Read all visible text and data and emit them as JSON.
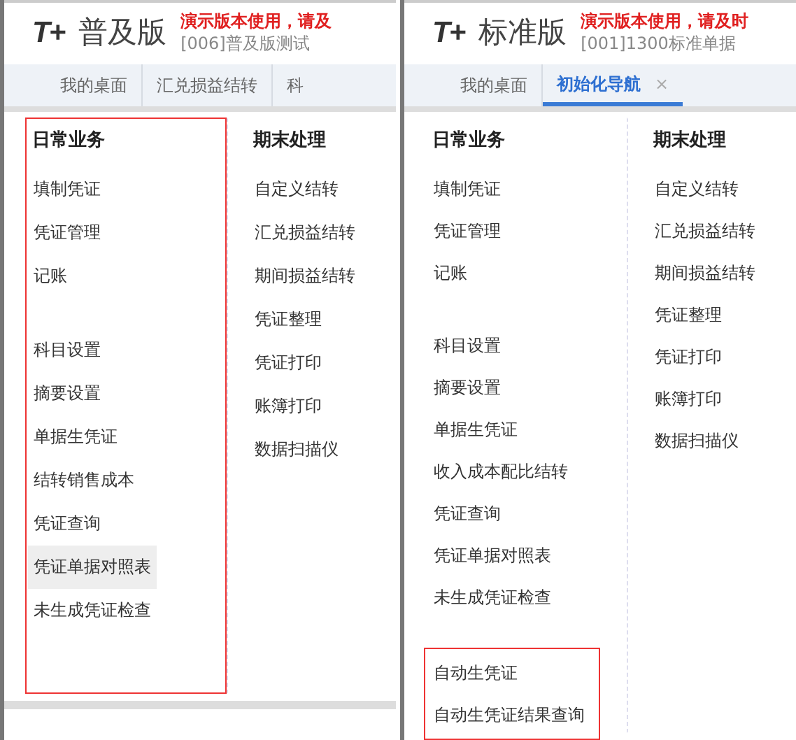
{
  "panels": [
    {
      "logo": {
        "mark": "T+",
        "edition": "普及版"
      },
      "notice": "演示版本使用，请及",
      "account": "[006]普及版测试",
      "tabs": [
        {
          "label": "我的桌面",
          "selected": false
        },
        {
          "label": "汇兑损益结转",
          "selected": false
        },
        {
          "label": "科",
          "selected": false
        }
      ],
      "columns": [
        {
          "title": "日常业务",
          "boxed": true,
          "groups": [
            {
              "items": [
                {
                  "label": "填制凭证",
                  "highlighted": false
                },
                {
                  "label": "凭证管理",
                  "highlighted": false
                },
                {
                  "label": "记账",
                  "highlighted": false
                }
              ]
            },
            {
              "items": [
                {
                  "label": "科目设置",
                  "highlighted": false
                },
                {
                  "label": "摘要设置",
                  "highlighted": false
                },
                {
                  "label": "单据生凭证",
                  "highlighted": false
                },
                {
                  "label": "结转销售成本",
                  "highlighted": false
                },
                {
                  "label": "凭证查询",
                  "highlighted": false
                },
                {
                  "label": "凭证单据对照表",
                  "highlighted": true
                },
                {
                  "label": "未生成凭证检查",
                  "highlighted": false
                }
              ]
            }
          ]
        },
        {
          "title": "期末处理",
          "groups": [
            {
              "items": [
                {
                  "label": "自定义结转",
                  "highlighted": false
                },
                {
                  "label": "汇兑损益结转",
                  "highlighted": false
                },
                {
                  "label": "期间损益结转",
                  "highlighted": false
                },
                {
                  "label": "凭证整理",
                  "highlighted": false
                },
                {
                  "label": "凭证打印",
                  "highlighted": false
                },
                {
                  "label": "账簿打印",
                  "highlighted": false
                },
                {
                  "label": "数据扫描仪",
                  "highlighted": false
                }
              ]
            }
          ]
        }
      ]
    },
    {
      "logo": {
        "mark": "T+",
        "edition": "标准版"
      },
      "notice": "演示版本使用，请及时",
      "account": "[001]1300标准单据",
      "tabs": [
        {
          "label": "我的桌面",
          "selected": false
        },
        {
          "label": "初始化导航",
          "selected": true,
          "close": "×"
        }
      ],
      "columns": [
        {
          "title": "日常业务",
          "groups": [
            {
              "items": [
                {
                  "label": "填制凭证",
                  "highlighted": false
                },
                {
                  "label": "凭证管理",
                  "highlighted": false
                },
                {
                  "label": "记账",
                  "highlighted": false
                }
              ]
            },
            {
              "items": [
                {
                  "label": "科目设置",
                  "highlighted": false
                },
                {
                  "label": "摘要设置",
                  "highlighted": false
                },
                {
                  "label": "单据生凭证",
                  "highlighted": false
                },
                {
                  "label": "收入成本配比结转",
                  "highlighted": false
                },
                {
                  "label": "凭证查询",
                  "highlighted": false
                },
                {
                  "label": "凭证单据对照表",
                  "highlighted": false
                },
                {
                  "label": "未生成凭证检查",
                  "highlighted": false
                }
              ]
            },
            {
              "boxed": true,
              "items": [
                {
                  "label": "自动生凭证",
                  "highlighted": false
                },
                {
                  "label": "自动生凭证结果查询",
                  "highlighted": false
                }
              ]
            }
          ]
        },
        {
          "title": "期末处理",
          "groups": [
            {
              "items": [
                {
                  "label": "自定义结转",
                  "highlighted": false
                },
                {
                  "label": "汇兑损益结转",
                  "highlighted": false
                },
                {
                  "label": "期间损益结转",
                  "highlighted": false
                },
                {
                  "label": "凭证整理",
                  "highlighted": false
                },
                {
                  "label": "凭证打印",
                  "highlighted": false
                },
                {
                  "label": "账簿打印",
                  "highlighted": false
                },
                {
                  "label": "数据扫描仪",
                  "highlighted": false
                }
              ]
            }
          ]
        }
      ]
    }
  ]
}
